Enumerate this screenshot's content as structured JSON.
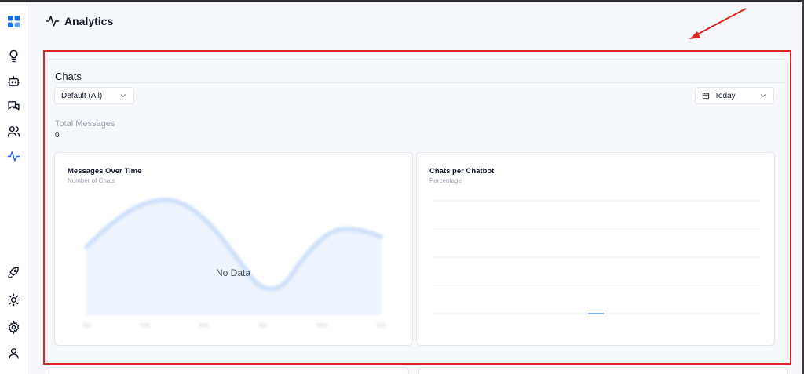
{
  "sidebar": {
    "items": [
      {
        "name": "logo",
        "icon": "grid-logo-icon"
      },
      {
        "name": "ideas",
        "icon": "lightbulb-icon"
      },
      {
        "name": "bots",
        "icon": "bot-icon"
      },
      {
        "name": "conversations",
        "icon": "chat-bubbles-icon"
      },
      {
        "name": "users",
        "icon": "users-icon"
      },
      {
        "name": "analytics",
        "icon": "activity-icon",
        "active": true
      },
      {
        "name": "launch",
        "icon": "rocket-icon"
      },
      {
        "name": "theme",
        "icon": "sun-icon"
      },
      {
        "name": "settings",
        "icon": "gear-icon"
      },
      {
        "name": "profile",
        "icon": "user-icon"
      }
    ]
  },
  "header": {
    "title": "Analytics"
  },
  "chats": {
    "title": "Chats",
    "chatbot_select": "Default (All)",
    "date_select": "Today",
    "total_label": "Total Messages",
    "total_value": "0"
  },
  "cards": {
    "messages": {
      "title": "Messages Over Time",
      "subtitle": "Number of Chats",
      "empty_text": "No Data",
      "months": [
        "Jan",
        "Feb",
        "Mar",
        "Apr",
        "May",
        "Jun"
      ]
    },
    "chatbot": {
      "title": "Chats per Chatbot",
      "subtitle": "Percentage"
    }
  },
  "colors": {
    "accent": "#2563eb",
    "annotation": "#dc2626",
    "placeholder_wave": "#cfe0fb"
  }
}
